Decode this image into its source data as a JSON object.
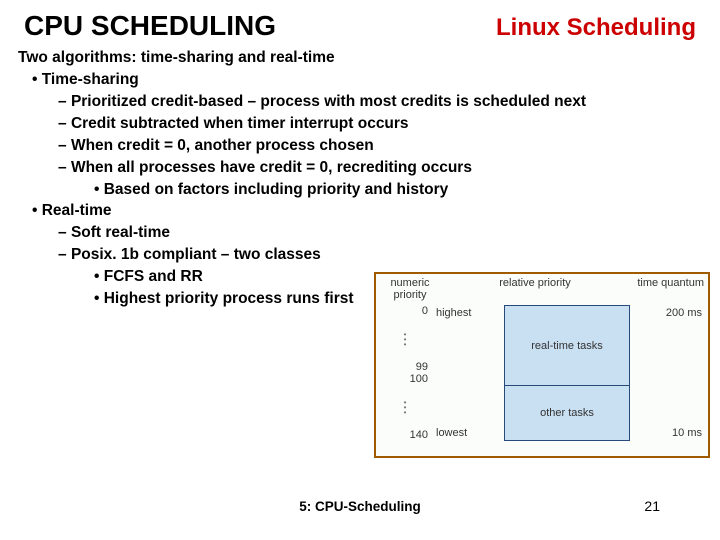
{
  "header": {
    "left": "CPU SCHEDULING",
    "right": "Linux Scheduling"
  },
  "lines": {
    "intro": "Two algorithms: time-sharing and real-time",
    "ts_head": "Time-sharing",
    "ts1": "Prioritized credit-based – process with most credits is scheduled next",
    "ts2": "Credit subtracted when timer interrupt occurs",
    "ts3": "When credit = 0, another process chosen",
    "ts4": "When all processes have credit = 0, recrediting occurs",
    "ts4a": "Based on factors including priority and history",
    "rt_head": "Real-time",
    "rt1": "Soft real-time",
    "rt2": "Posix. 1b compliant – two classes",
    "rt2a": "FCFS and RR",
    "rt2b": "Highest priority process runs first"
  },
  "figure": {
    "head": {
      "numeric": "numeric priority",
      "relative": "relative priority",
      "time": "time quantum"
    },
    "numeric": {
      "top": "0",
      "mid1": "99",
      "mid2": "100",
      "bottom": "140"
    },
    "relative": {
      "top": "highest",
      "bottom": "lowest"
    },
    "tasks": {
      "box1": "real-time tasks",
      "box2": "other tasks"
    },
    "time": {
      "top": "200 ms",
      "bottom": "10 ms"
    }
  },
  "footer": {
    "center": "5: CPU-Scheduling",
    "page": "21"
  }
}
